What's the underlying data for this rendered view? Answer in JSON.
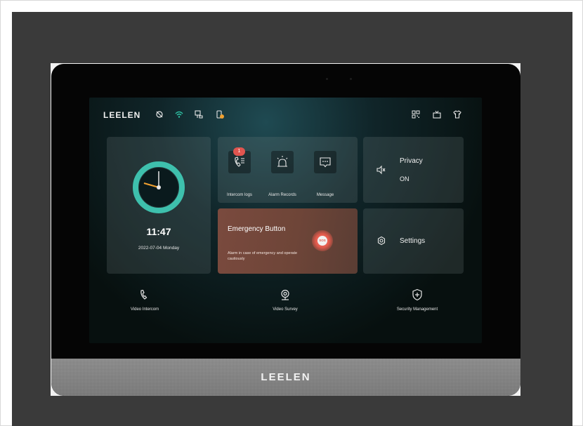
{
  "device": {
    "brand": "LEELEN",
    "grille_logo": "LEELEN"
  },
  "status_bar": {
    "left_icons": [
      "no-disturb-icon",
      "wifi-icon",
      "network-icon",
      "lock-alert-icon"
    ],
    "right_icons": [
      "qr-code-icon",
      "tv-icon",
      "shirt-icon"
    ],
    "accent": "#2ec4a6"
  },
  "clock": {
    "time": "11:47",
    "date": "2022-07-04  Monday",
    "ring_color": "#3ec0ad"
  },
  "quick_actions": {
    "items": [
      {
        "label": "Intercom logs",
        "icon": "call-log-icon",
        "badge": "1"
      },
      {
        "label": "Alarm Records",
        "icon": "alarm-light-icon"
      },
      {
        "label": "Message",
        "icon": "message-icon"
      }
    ]
  },
  "privacy": {
    "title": "Privacy",
    "value": "ON",
    "icon": "speaker-mute-icon"
  },
  "emergency": {
    "title": "Emergency Button",
    "description": "Alarm in case of emergency and operate cautiously",
    "button_label": "SOS",
    "color": "#e15a4c"
  },
  "settings": {
    "title": "Settings",
    "icon": "gear-icon"
  },
  "bottom_nav": {
    "items": [
      {
        "label": "Video Intercom",
        "icon": "phone-icon"
      },
      {
        "label": "Video Survey",
        "icon": "camera-icon"
      },
      {
        "label": "Security Management",
        "icon": "shield-plus-icon"
      }
    ]
  }
}
